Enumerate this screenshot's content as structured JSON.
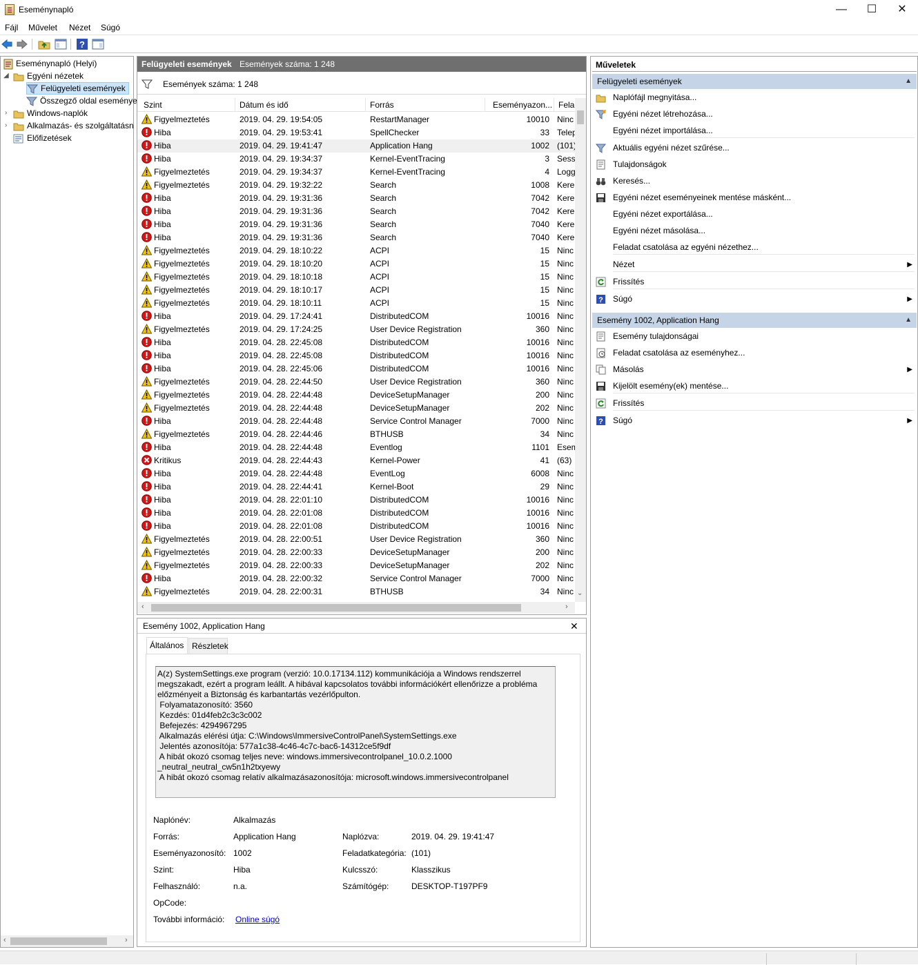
{
  "window": {
    "title": "Eseménynapló",
    "minimize": "—",
    "maximize": "☐",
    "close": "✕"
  },
  "menu": [
    "Fájl",
    "Művelet",
    "Nézet",
    "Súgó"
  ],
  "tree": {
    "root": "Eseménynapló (Helyi)",
    "custom_views": "Egyéni nézetek",
    "admin_events": "Felügyeleti események",
    "summary_events": "Összegző oldal eseménye",
    "windows_logs": "Windows-naplók",
    "app_logs": "Alkalmazás- és szolgáltatásn",
    "subscriptions": "Előfizetések"
  },
  "list": {
    "header_title": "Felügyeleti események",
    "header_count": "Események száma: 1 248",
    "filter_count": "Események száma: 1 248",
    "columns": [
      "Szint",
      "Dátum és idő",
      "Forrás",
      "Eseményazon...",
      "Felad"
    ],
    "rows": [
      {
        "level": "Figyelmeztetés",
        "type": "warn",
        "dt": "2019. 04. 29. 19:54:05",
        "src": "RestartManager",
        "id": "10010",
        "task": "Ninc"
      },
      {
        "level": "Hiba",
        "type": "err",
        "dt": "2019. 04. 29. 19:53:41",
        "src": "SpellChecker",
        "id": "33",
        "task": "Telep"
      },
      {
        "level": "Hiba",
        "type": "err",
        "dt": "2019. 04. 29. 19:41:47",
        "src": "Application Hang",
        "id": "1002",
        "task": "(101)"
      },
      {
        "level": "Hiba",
        "type": "err",
        "dt": "2019. 04. 29. 19:34:37",
        "src": "Kernel-EventTracing",
        "id": "3",
        "task": "Sess"
      },
      {
        "level": "Figyelmeztetés",
        "type": "warn",
        "dt": "2019. 04. 29. 19:34:37",
        "src": "Kernel-EventTracing",
        "id": "4",
        "task": "Logg"
      },
      {
        "level": "Figyelmeztetés",
        "type": "warn",
        "dt": "2019. 04. 29. 19:32:22",
        "src": "Search",
        "id": "1008",
        "task": "Kere"
      },
      {
        "level": "Hiba",
        "type": "err",
        "dt": "2019. 04. 29. 19:31:36",
        "src": "Search",
        "id": "7042",
        "task": "Kere"
      },
      {
        "level": "Hiba",
        "type": "err",
        "dt": "2019. 04. 29. 19:31:36",
        "src": "Search",
        "id": "7042",
        "task": "Kere"
      },
      {
        "level": "Hiba",
        "type": "err",
        "dt": "2019. 04. 29. 19:31:36",
        "src": "Search",
        "id": "7040",
        "task": "Kere"
      },
      {
        "level": "Hiba",
        "type": "err",
        "dt": "2019. 04. 29. 19:31:36",
        "src": "Search",
        "id": "7040",
        "task": "Kere"
      },
      {
        "level": "Figyelmeztetés",
        "type": "warn",
        "dt": "2019. 04. 29. 18:10:22",
        "src": "ACPI",
        "id": "15",
        "task": "Ninc"
      },
      {
        "level": "Figyelmeztetés",
        "type": "warn",
        "dt": "2019. 04. 29. 18:10:20",
        "src": "ACPI",
        "id": "15",
        "task": "Ninc"
      },
      {
        "level": "Figyelmeztetés",
        "type": "warn",
        "dt": "2019. 04. 29. 18:10:18",
        "src": "ACPI",
        "id": "15",
        "task": "Ninc"
      },
      {
        "level": "Figyelmeztetés",
        "type": "warn",
        "dt": "2019. 04. 29. 18:10:17",
        "src": "ACPI",
        "id": "15",
        "task": "Ninc"
      },
      {
        "level": "Figyelmeztetés",
        "type": "warn",
        "dt": "2019. 04. 29. 18:10:11",
        "src": "ACPI",
        "id": "15",
        "task": "Ninc"
      },
      {
        "level": "Hiba",
        "type": "err",
        "dt": "2019. 04. 29. 17:24:41",
        "src": "DistributedCOM",
        "id": "10016",
        "task": "Ninc"
      },
      {
        "level": "Figyelmeztetés",
        "type": "warn",
        "dt": "2019. 04. 29. 17:24:25",
        "src": "User Device Registration",
        "id": "360",
        "task": "Ninc"
      },
      {
        "level": "Hiba",
        "type": "err",
        "dt": "2019. 04. 28. 22:45:08",
        "src": "DistributedCOM",
        "id": "10016",
        "task": "Ninc"
      },
      {
        "level": "Hiba",
        "type": "err",
        "dt": "2019. 04. 28. 22:45:08",
        "src": "DistributedCOM",
        "id": "10016",
        "task": "Ninc"
      },
      {
        "level": "Hiba",
        "type": "err",
        "dt": "2019. 04. 28. 22:45:06",
        "src": "DistributedCOM",
        "id": "10016",
        "task": "Ninc"
      },
      {
        "level": "Figyelmeztetés",
        "type": "warn",
        "dt": "2019. 04. 28. 22:44:50",
        "src": "User Device Registration",
        "id": "360",
        "task": "Ninc"
      },
      {
        "level": "Figyelmeztetés",
        "type": "warn",
        "dt": "2019. 04. 28. 22:44:48",
        "src": "DeviceSetupManager",
        "id": "200",
        "task": "Ninc"
      },
      {
        "level": "Figyelmeztetés",
        "type": "warn",
        "dt": "2019. 04. 28. 22:44:48",
        "src": "DeviceSetupManager",
        "id": "202",
        "task": "Ninc"
      },
      {
        "level": "Hiba",
        "type": "err",
        "dt": "2019. 04. 28. 22:44:48",
        "src": "Service Control Manager",
        "id": "7000",
        "task": "Ninc"
      },
      {
        "level": "Figyelmeztetés",
        "type": "warn",
        "dt": "2019. 04. 28. 22:44:46",
        "src": "BTHUSB",
        "id": "34",
        "task": "Ninc"
      },
      {
        "level": "Hiba",
        "type": "err",
        "dt": "2019. 04. 28. 22:44:48",
        "src": "Eventlog",
        "id": "1101",
        "task": "Esem"
      },
      {
        "level": "Kritikus",
        "type": "crit",
        "dt": "2019. 04. 28. 22:44:43",
        "src": "Kernel-Power",
        "id": "41",
        "task": "(63)"
      },
      {
        "level": "Hiba",
        "type": "err",
        "dt": "2019. 04. 28. 22:44:48",
        "src": "EventLog",
        "id": "6008",
        "task": "Ninc"
      },
      {
        "level": "Hiba",
        "type": "err",
        "dt": "2019. 04. 28. 22:44:41",
        "src": "Kernel-Boot",
        "id": "29",
        "task": "Ninc"
      },
      {
        "level": "Hiba",
        "type": "err",
        "dt": "2019. 04. 28. 22:01:10",
        "src": "DistributedCOM",
        "id": "10016",
        "task": "Ninc"
      },
      {
        "level": "Hiba",
        "type": "err",
        "dt": "2019. 04. 28. 22:01:08",
        "src": "DistributedCOM",
        "id": "10016",
        "task": "Ninc"
      },
      {
        "level": "Hiba",
        "type": "err",
        "dt": "2019. 04. 28. 22:01:08",
        "src": "DistributedCOM",
        "id": "10016",
        "task": "Ninc"
      },
      {
        "level": "Figyelmeztetés",
        "type": "warn",
        "dt": "2019. 04. 28. 22:00:51",
        "src": "User Device Registration",
        "id": "360",
        "task": "Ninc"
      },
      {
        "level": "Figyelmeztetés",
        "type": "warn",
        "dt": "2019. 04. 28. 22:00:33",
        "src": "DeviceSetupManager",
        "id": "200",
        "task": "Ninc"
      },
      {
        "level": "Figyelmeztetés",
        "type": "warn",
        "dt": "2019. 04. 28. 22:00:33",
        "src": "DeviceSetupManager",
        "id": "202",
        "task": "Ninc"
      },
      {
        "level": "Hiba",
        "type": "err",
        "dt": "2019. 04. 28. 22:00:32",
        "src": "Service Control Manager",
        "id": "7000",
        "task": "Ninc"
      },
      {
        "level": "Figyelmeztetés",
        "type": "warn",
        "dt": "2019. 04. 28. 22:00:31",
        "src": "BTHUSB",
        "id": "34",
        "task": "Ninc"
      }
    ]
  },
  "detail": {
    "title": "Esemény 1002, Application Hang",
    "tab_general": "Általános",
    "tab_details": "Részletek",
    "description": [
      "A(z) SystemSettings.exe program (verzió: 10.0.17134.112) kommunikációja a Windows rendszerrel",
      "megszakadt, ezért a program leállt. A hibával kapcsolatos további információkért ellenőrizze a probléma",
      "előzményeit a Biztonság és karbantartás vezérlőpulton.",
      " Folyamatazonosító: 3560",
      " Kezdés: 01d4feb2c3c3c002",
      " Befejezés: 4294967295",
      " Alkalmazás elérési útja: C:\\Windows\\ImmersiveControlPanel\\SystemSettings.exe",
      " Jelentés azonosítója: 577a1c38-4c46-4c7c-bac6-14312ce5f9df",
      " A hibát okozó csomag teljes neve: windows.immersivecontrolpanel_10.0.2.1000",
      "_neutral_neutral_cw5n1h2txyewy",
      " A hibát okozó csomag relatív alkalmazásazonosítója: microsoft.windows.immersivecontrolpanel"
    ],
    "labels": {
      "log_name": "Naplónév:",
      "source": "Forrás:",
      "event_id": "Eseményazonosító:",
      "level": "Szint:",
      "user": "Felhasználó:",
      "opcode": "OpCode:",
      "more_info": "További információ:",
      "logged": "Naplózva:",
      "task_category": "Feladatkategória:",
      "keywords": "Kulcsszó:",
      "computer": "Számítógép:"
    },
    "values": {
      "log_name": "Alkalmazás",
      "source": "Application Hang",
      "event_id": "1002",
      "level": "Hiba",
      "user": "n.a.",
      "more_info_link": "Online súgó",
      "logged": "2019. 04. 29. 19:41:47",
      "task_category": "(101)",
      "keywords": "Klasszikus",
      "computer": "DESKTOP-T197PF9"
    }
  },
  "actions": {
    "title": "Műveletek",
    "section1": "Felügyeleti események",
    "items1": [
      "Naplófájl megnyitása...",
      "Egyéni nézet létrehozása...",
      "Egyéni nézet importálása...",
      "Aktuális egyéni nézet szűrése...",
      "Tulajdonságok",
      "Keresés...",
      "Egyéni nézet eseményeinek mentése másként...",
      "Egyéni nézet exportálása...",
      "Egyéni nézet másolása...",
      "Feladat csatolása az egyéni nézethez...",
      "Nézet",
      "Frissítés",
      "Súgó"
    ],
    "section2": "Esemény 1002, Application Hang",
    "items2": [
      "Esemény tulajdonságai",
      "Feladat csatolása az eseményhez...",
      "Másolás",
      "Kijelölt esemény(ek) mentése...",
      "Frissítés",
      "Súgó"
    ]
  },
  "colors": {
    "selection": "#f0f0f0",
    "section_bg": "#c5d5e7",
    "header_bg": "#6f6f6f"
  }
}
